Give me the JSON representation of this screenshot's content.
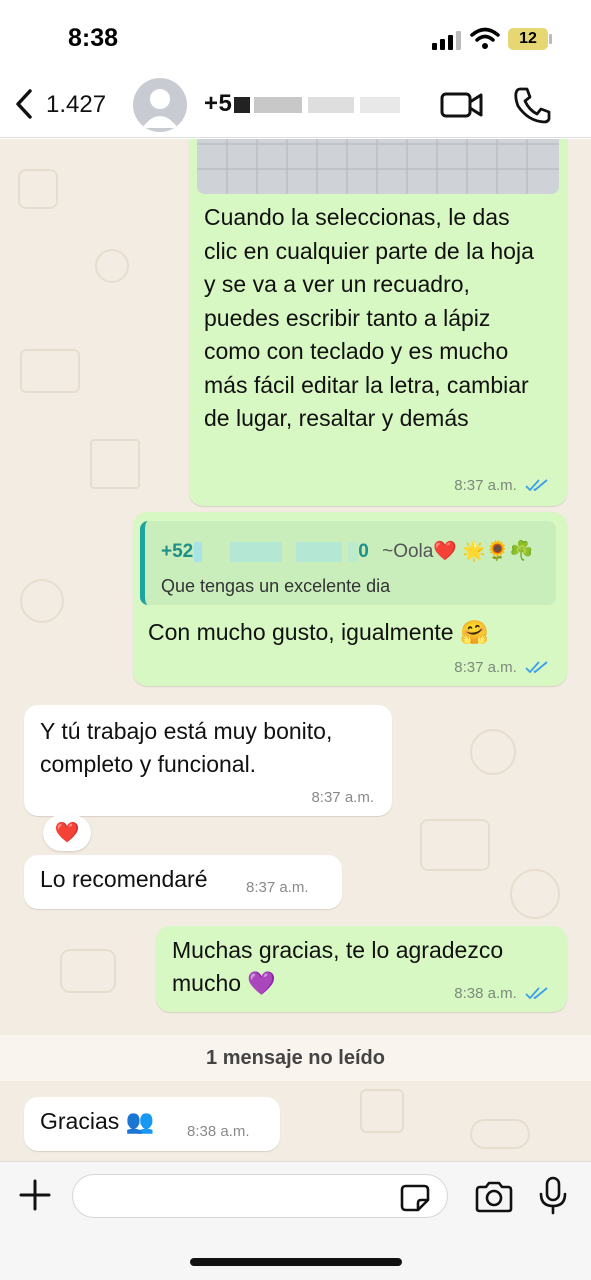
{
  "status_bar": {
    "time": "8:38",
    "battery": "12"
  },
  "header": {
    "back_count": "1.427",
    "contact_name": "+5"
  },
  "messages": [
    {
      "text": "Cuando la seleccionas, le das clic en cualquier parte de la hoja y se va a ver un recuadro, puedes escribir tanto a lápiz como con teclado y es mucho más fácil editar la letra, cambiar de lugar, resaltar y demás",
      "time": "8:37 a.m."
    },
    {
      "quote_sender_prefix": "+52",
      "quote_sender_suffix": "0",
      "quote_sender_tag": "~Oola❤️ 🌟🌻☘️",
      "quote_text": "Que tengas un excelente dia",
      "text": "Con mucho gusto, igualmente 🤗",
      "time": "8:37 a.m."
    },
    {
      "text_line1": "Y tú trabajo está muy bonito,",
      "text_line2": "completo y funcional.",
      "time": "8:37 a.m.",
      "reaction": "❤️"
    },
    {
      "text": "Lo recomendaré",
      "time": "8:37 a.m."
    },
    {
      "text_line1": "Muchas gracias, te lo agradezco",
      "text_line2": "mucho 💜",
      "time": "8:38 a.m."
    },
    {
      "text": "Gracias 👥",
      "time": "8:38 a.m."
    }
  ],
  "unread_label": "1 mensaje no leído",
  "colors": {
    "outgoing": "#d7f8c2",
    "incoming": "#ffffff",
    "chat_bg": "#f3ece2",
    "tick": "#3b9ee8",
    "quote_name": "#1e8f8a"
  },
  "icons": [
    "back-chevron-icon",
    "avatar",
    "video-call-icon",
    "phone-icon",
    "plus-icon",
    "sticker-icon",
    "camera-icon",
    "mic-icon",
    "read-ticks-icon"
  ]
}
